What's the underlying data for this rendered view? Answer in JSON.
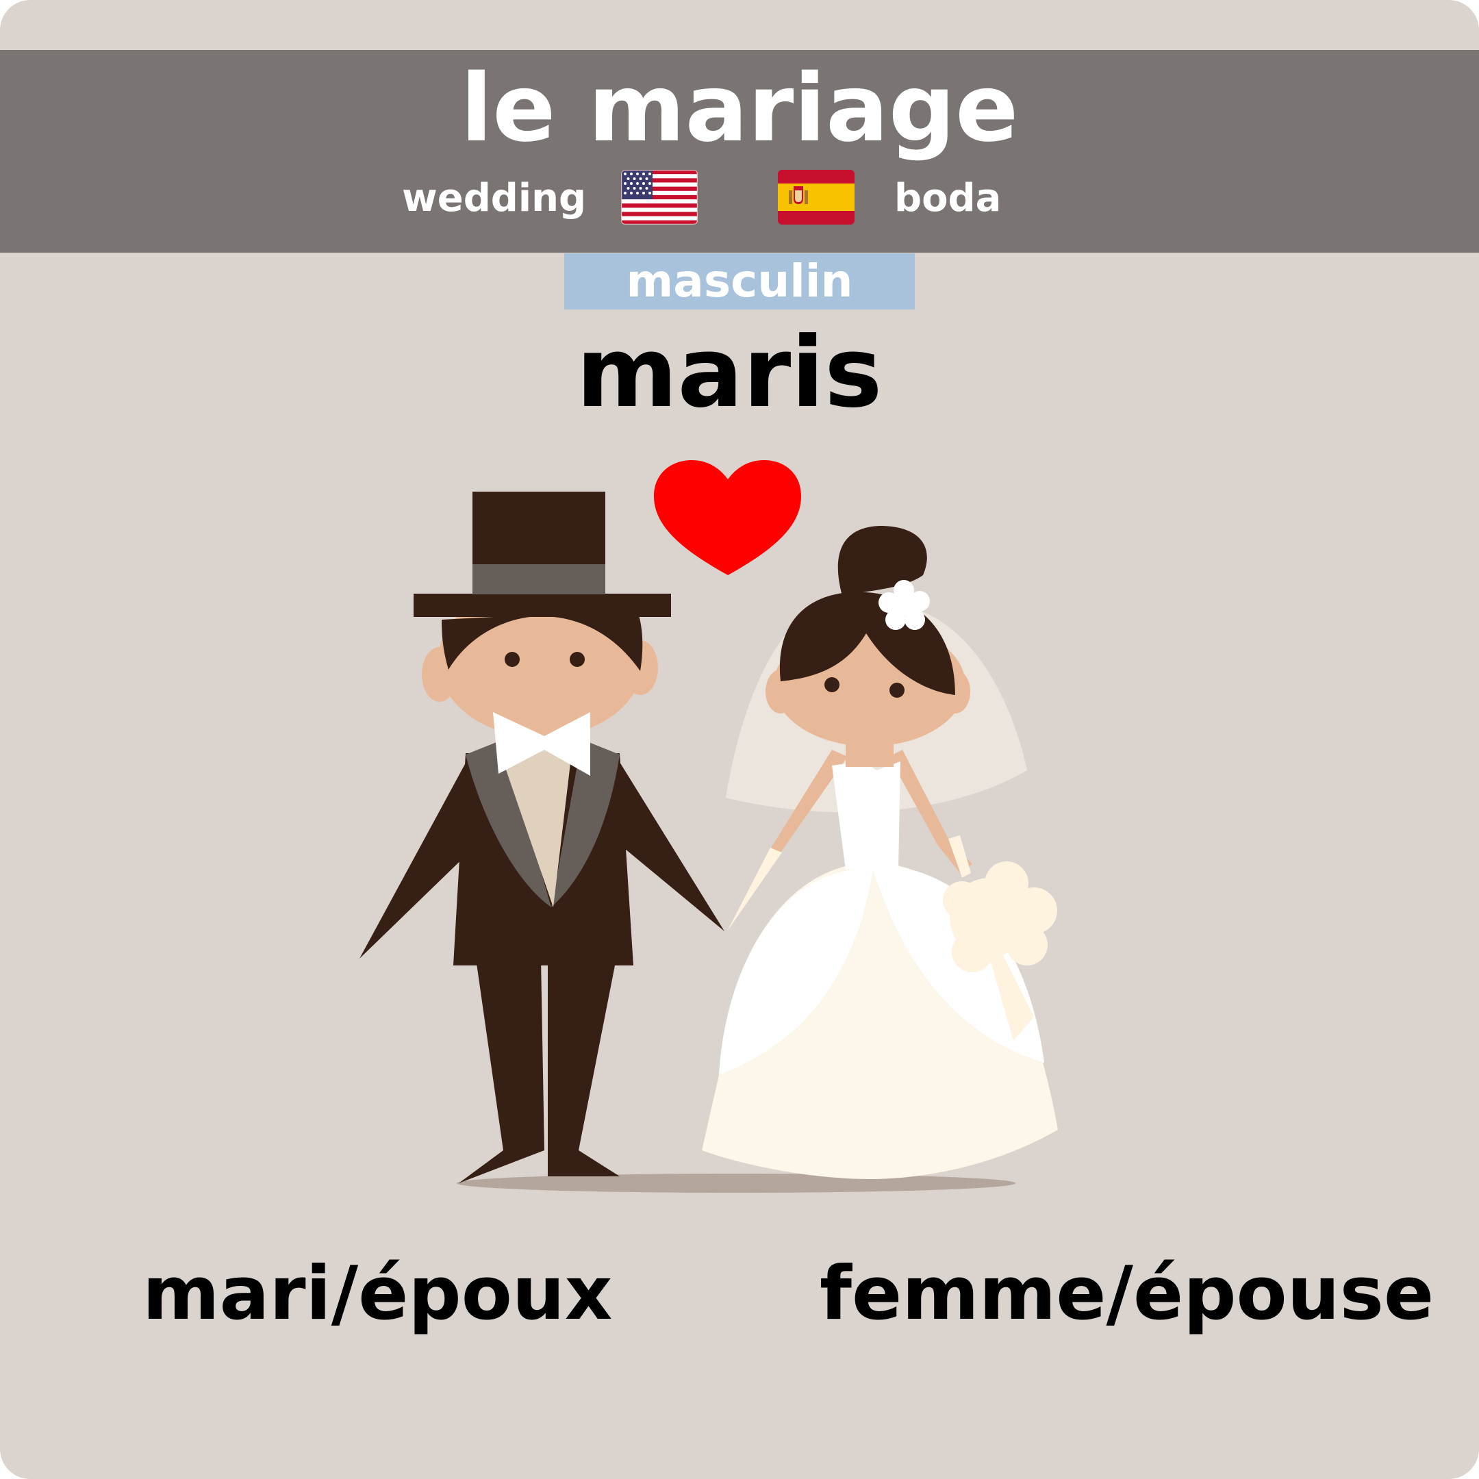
{
  "card": {
    "title": "le mariage",
    "translations": {
      "english": "wedding",
      "spanish": "boda"
    },
    "flags": {
      "english": "us-flag-icon",
      "spanish": "spain-flag-icon"
    },
    "gender": "masculin",
    "plural": "maris",
    "labels": {
      "left": "mari/époux",
      "right": "femme/épouse"
    }
  },
  "colors": {
    "background": "#dbd3cd",
    "header": "#7a7572",
    "gender_tag": "#a9c2dc",
    "heart": "#ff0000",
    "suit": "#361f14",
    "skin": "#e8b998",
    "dress": "#fdf6ea"
  }
}
